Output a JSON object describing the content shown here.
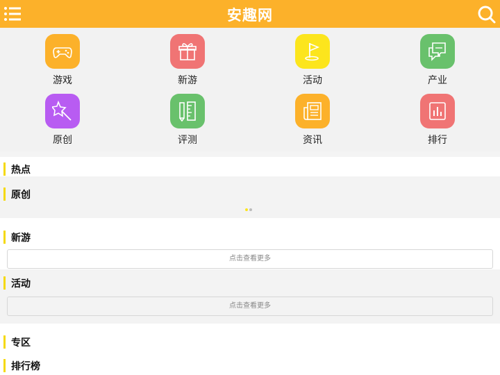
{
  "header": {
    "title": "安趣网",
    "menu_icon": "list-menu-icon",
    "search_icon": "search-icon",
    "color": "#fcb12a"
  },
  "categories": [
    {
      "label": "游戏",
      "icon": "gamepad-icon",
      "color": "#fcb12a"
    },
    {
      "label": "新游",
      "icon": "gift-icon",
      "color": "#f07474"
    },
    {
      "label": "活动",
      "icon": "flag-icon",
      "color": "#fce51d"
    },
    {
      "label": "产业",
      "icon": "chat-bubbles-icon",
      "color": "#69c16c"
    },
    {
      "label": "原创",
      "icon": "magic-wand-icon",
      "color": "#b85cf2"
    },
    {
      "label": "评测",
      "icon": "ruler-pencil-icon",
      "color": "#69c16c"
    },
    {
      "label": "资讯",
      "icon": "newspaper-icon",
      "color": "#fcb12a"
    },
    {
      "label": "排行",
      "icon": "bar-chart-icon",
      "color": "#f07474"
    }
  ],
  "sections": {
    "hot": "热点",
    "original": "原创",
    "new_games": "新游",
    "activity": "活动",
    "zone": "专区",
    "ranking": "排行榜"
  },
  "carousel": {
    "active_dot_color": "#fce51d",
    "dot_color": "#bbbbbb"
  },
  "more_label": "点击查看更多",
  "section_bar_color": "#f5d90c"
}
